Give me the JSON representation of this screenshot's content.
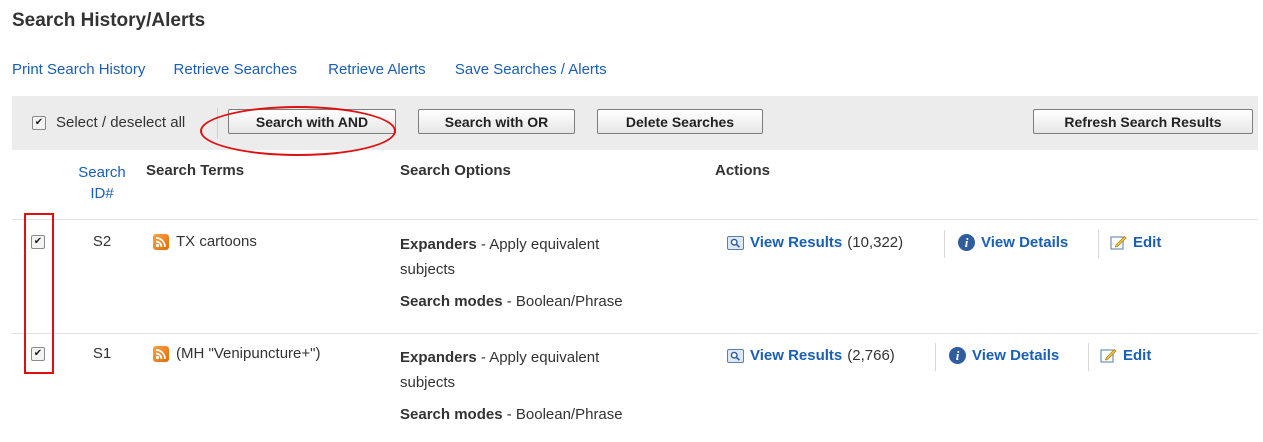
{
  "page": {
    "title": "Search History/Alerts",
    "links": [
      "Print Search History",
      "Retrieve Searches",
      "Retrieve Alerts",
      "Save Searches / Alerts"
    ]
  },
  "toolbar": {
    "select_all_label": "Select / deselect all",
    "select_all_checked": true,
    "btn_and": "Search with AND",
    "btn_or": "Search with OR",
    "btn_delete": "Delete Searches",
    "btn_refresh": "Refresh Search Results"
  },
  "columns": {
    "search_id_line1": "Search",
    "search_id_line2": "ID#",
    "terms": "Search Terms",
    "options": "Search Options",
    "actions": "Actions"
  },
  "rows": [
    {
      "checked": true,
      "id": "S2",
      "term": "TX cartoons",
      "expanders_label": "Expanders",
      "expanders_value": " - Apply equivalent",
      "expanders_value2": "subjects",
      "modes_label": "Search modes",
      "modes_value": " - Boolean/Phrase",
      "view_results": "View Results",
      "count": "(10,322)",
      "view_details": "View Details",
      "edit": "Edit"
    },
    {
      "checked": true,
      "id": "S1",
      "term": "(MH \"Venipuncture+\")",
      "expanders_label": "Expanders",
      "expanders_value": " - Apply equivalent",
      "expanders_value2": "subjects",
      "modes_label": "Search modes",
      "modes_value": " - Boolean/Phrase",
      "view_results": "View Results",
      "count": "(2,766)",
      "view_details": "View Details",
      "edit": "Edit"
    }
  ],
  "colors": {
    "link": "#1a5fb4",
    "highlight": "#dd1111",
    "toolbar_bg": "#ececec"
  }
}
